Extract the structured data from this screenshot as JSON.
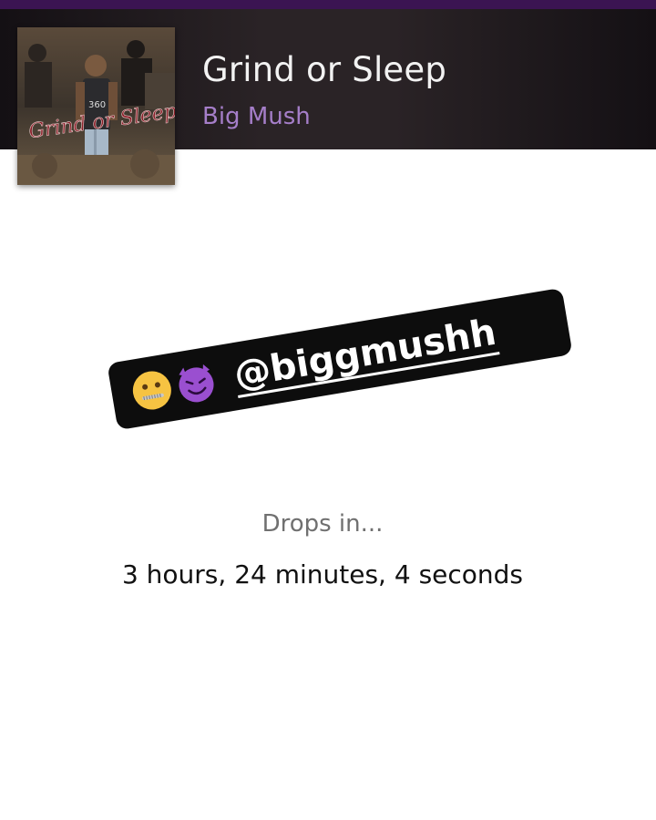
{
  "header": {
    "title": "Grind or Sleep",
    "artist": "Big Mush",
    "accent_color": "#a57ec9",
    "strip_color": "#3b1452"
  },
  "album_art": {
    "cover_text": "Grind or Sleep",
    "shirt_text": "360"
  },
  "sticker": {
    "emojis": [
      "zipper-mouth-face-icon",
      "smiling-devil-face-icon"
    ],
    "handle": "@biggmushh"
  },
  "countdown": {
    "label": "Drops in...",
    "time_remaining": "3 hours, 24 minutes, 4 seconds"
  }
}
